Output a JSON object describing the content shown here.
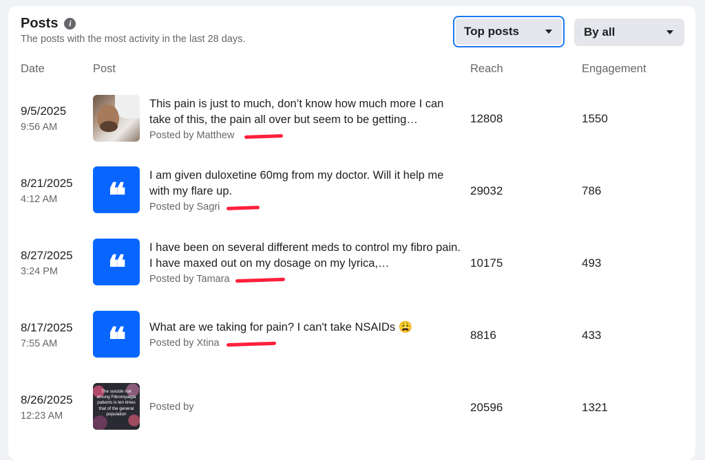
{
  "header": {
    "title": "Posts",
    "subtitle": "The posts with the most activity in the last 28 days.",
    "info_icon": "info-icon"
  },
  "filters": {
    "sort_label": "Top posts",
    "filter_label": "By all"
  },
  "columns": {
    "date": "Date",
    "post": "Post",
    "reach": "Reach",
    "engagement": "Engagement"
  },
  "rows": [
    {
      "date": "9/5/2025",
      "time": "9:56 AM",
      "thumbnail": "photo",
      "text": "This pain is just to much, don’t know how much more I can take of this, the pain all over but seem to be getting…",
      "posted_by": "Posted by Matthew",
      "reach": "12808",
      "engagement": "1550"
    },
    {
      "date": "8/21/2025",
      "time": "4:12 AM",
      "thumbnail": "quote-icon",
      "text": "I am given duloxetine 60mg from my doctor. Will it help me with my flare up.",
      "posted_by": "Posted by Sagri",
      "reach": "29032",
      "engagement": "786"
    },
    {
      "date": "8/27/2025",
      "time": "3:24 PM",
      "thumbnail": "quote-icon",
      "text": "I have been on several different meds to control my fibro pain. I have maxed out on my dosage on my lyrica,…",
      "posted_by": "Posted by Tamara",
      "reach": "10175",
      "engagement": "493"
    },
    {
      "date": "8/17/2025",
      "time": "7:55 AM",
      "thumbnail": "quote-icon",
      "text": "What are we taking for pain? I can't take NSAIDs 😩",
      "posted_by": "Posted by Xtina",
      "reach": "8816",
      "engagement": "433"
    },
    {
      "date": "8/26/2025",
      "time": "12:23 AM",
      "thumbnail": "image",
      "thumbnail_text": "The suicide risk among Fibromyalgia patients is ten times that of the general population",
      "text": "",
      "posted_by": "Posted by",
      "reach": "20596",
      "engagement": "1321"
    }
  ],
  "colors": {
    "accent": "#0866ff",
    "redaction": "#ff1f3d",
    "muted_text": "#65676b"
  }
}
